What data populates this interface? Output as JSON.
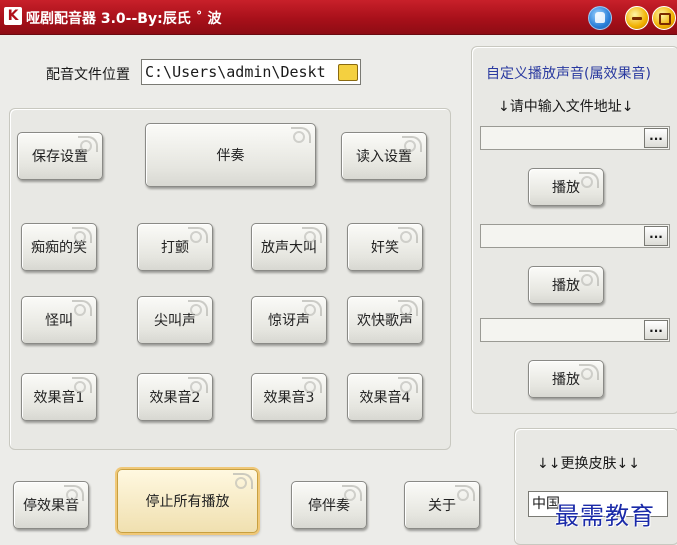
{
  "window": {
    "title": "哑剧配音器 3.0--By:辰氏 ˚ 波"
  },
  "file": {
    "label": "配音文件位置",
    "path": "C:\\Users\\admin\\Deskt"
  },
  "left_buttons": {
    "save": "保存设置",
    "accompany": "伴奏",
    "load": "读入设置",
    "row1": [
      "痴痴的笑",
      "打颤",
      "放声大叫",
      "奸笑"
    ],
    "row2": [
      "怪叫",
      "尖叫声",
      "惊讶声",
      "欢快歌声"
    ],
    "row3": [
      "效果音1",
      "效果音2",
      "效果音3",
      "效果音4"
    ]
  },
  "bottom_buttons": {
    "stop_effect": "停效果音",
    "stop_all": "停止所有播放",
    "stop_accompany": "停伴奏",
    "about": "关于"
  },
  "custom": {
    "title": "自定义播放声音(属效果音)",
    "hint": "↓请中输入文件地址↓",
    "browse": "...",
    "play": "播放"
  },
  "skin": {
    "label": "↓↓更换皮肤↓↓",
    "selected": "中国"
  },
  "watermark": "最需教育"
}
